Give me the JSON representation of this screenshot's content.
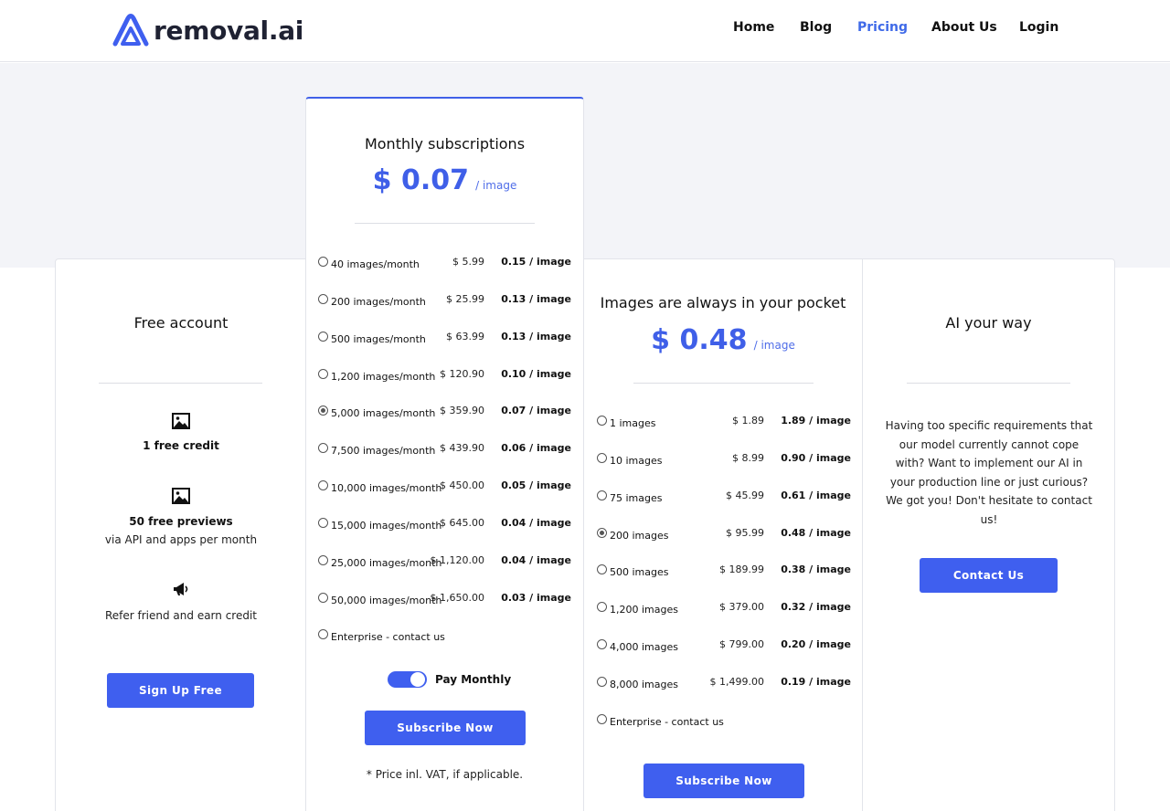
{
  "brand": {
    "name": "removal.ai"
  },
  "nav": {
    "home": "Home",
    "blog": "Blog",
    "pricing": "Pricing",
    "about": "About Us",
    "login": "Login"
  },
  "colors": {
    "accent": "#3f5fef",
    "band": "#f3f4f8"
  },
  "free": {
    "title": "Free account",
    "feature1": {
      "icon": "image-icon",
      "bold": "1 free credit"
    },
    "feature2": {
      "icon": "image-icon",
      "bold": "50 free previews",
      "text": "via API and apps per month"
    },
    "feature3": {
      "icon": "megaphone-icon",
      "text": "Refer friend and earn credit"
    },
    "button": "Sign Up Free"
  },
  "monthly": {
    "title": "Monthly subscriptions",
    "price": "$ 0.07",
    "per": "/ image",
    "plans": [
      {
        "name": "40 images/month",
        "price": "$ 5.99",
        "unit": "0.15 / image",
        "selected": false
      },
      {
        "name": "200 images/month",
        "price": "$ 25.99",
        "unit": "0.13 / image",
        "selected": false
      },
      {
        "name": "500 images/month",
        "price": "$ 63.99",
        "unit": "0.13 / image",
        "selected": false
      },
      {
        "name": "1,200 images/month",
        "price": "$ 120.90",
        "unit": "0.10 / image",
        "selected": false
      },
      {
        "name": "5,000 images/month",
        "price": "$ 359.90",
        "unit": "0.07 / image",
        "selected": true
      },
      {
        "name": "7,500 images/month",
        "price": "$ 439.90",
        "unit": "0.06 / image",
        "selected": false
      },
      {
        "name": "10,000 images/month",
        "price": "$ 450.00",
        "unit": "0.05 / image",
        "selected": false
      },
      {
        "name": "15,000 images/month",
        "price": "$ 645.00",
        "unit": "0.04 / image",
        "selected": false
      },
      {
        "name": "25,000 images/month",
        "price": "$ 1,120.00",
        "unit": "0.04 / image",
        "selected": false
      },
      {
        "name": "50,000 images/month",
        "price": "$ 1,650.00",
        "unit": "0.03 / image",
        "selected": false
      }
    ],
    "enterprise": "Enterprise - contact us",
    "toggle_label": "Pay Monthly",
    "toggle_on": true,
    "button": "Subscribe Now",
    "note": "* Price inl. VAT, if applicable."
  },
  "payg": {
    "title": "Images are always in your pocket",
    "price": "$ 0.48",
    "per": "/ image",
    "plans": [
      {
        "name": "1 images",
        "price": "$ 1.89",
        "unit": "1.89 / image",
        "selected": false
      },
      {
        "name": "10 images",
        "price": "$ 8.99",
        "unit": "0.90 / image",
        "selected": false
      },
      {
        "name": "75 images",
        "price": "$ 45.99",
        "unit": "0.61 / image",
        "selected": false
      },
      {
        "name": "200 images",
        "price": "$ 95.99",
        "unit": "0.48 / image",
        "selected": true
      },
      {
        "name": "500 images",
        "price": "$ 189.99",
        "unit": "0.38 / image",
        "selected": false
      },
      {
        "name": "1,200 images",
        "price": "$ 379.00",
        "unit": "0.32 / image",
        "selected": false
      },
      {
        "name": "4,000 images",
        "price": "$ 799.00",
        "unit": "0.20 / image",
        "selected": false
      },
      {
        "name": "8,000 images",
        "price": "$ 1,499.00",
        "unit": "0.19 / image",
        "selected": false
      }
    ],
    "enterprise": "Enterprise - contact us",
    "button": "Subscribe Now"
  },
  "ai": {
    "title": "AI your way",
    "description": "Having too specific requirements that our model currently cannot cope with? Want to implement our AI in your production line or just curious? We got you! Don't hesitate to contact us!",
    "button": "Contact Us"
  }
}
